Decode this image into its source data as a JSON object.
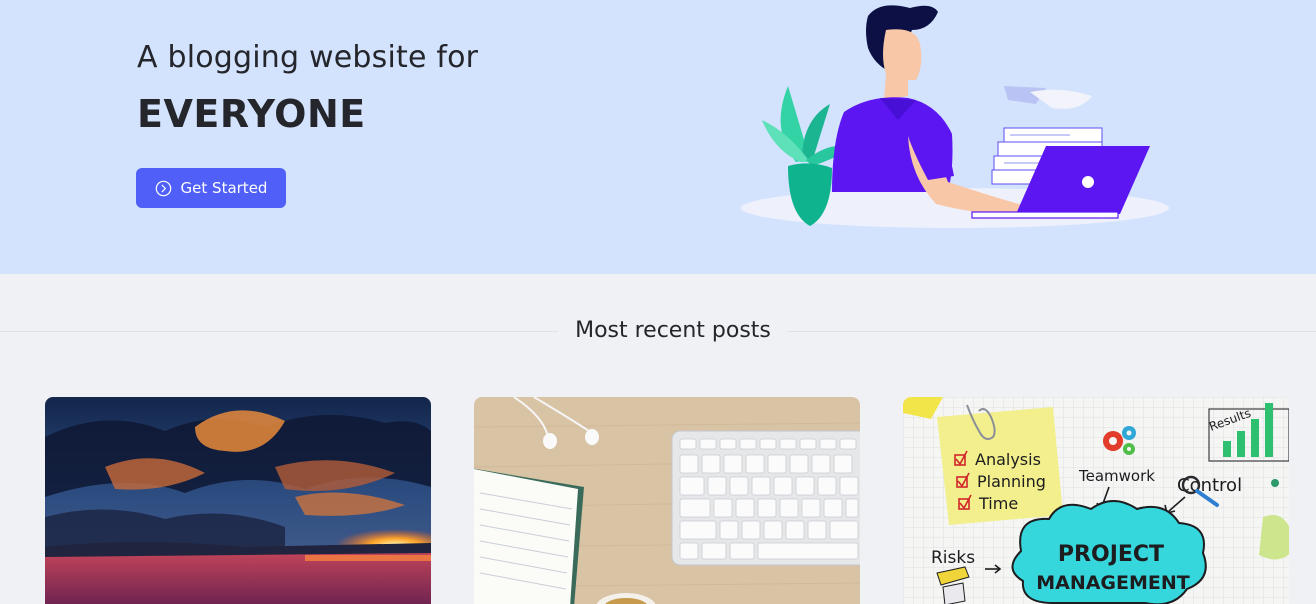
{
  "hero": {
    "subtitle": "A blogging website for",
    "title": "EVERYONE",
    "cta_label": "Get Started",
    "cta_icon": "circle-chevron-right-icon",
    "background": "#d3e3fd",
    "accent": "#4f5ff7"
  },
  "recent": {
    "heading": "Most recent posts",
    "cards": [
      {
        "image": "sunset-clouds-photo"
      },
      {
        "image": "desk-keyboard-earphones-photo"
      },
      {
        "image": "project-management-sketch-photo",
        "note_lines": [
          "Analysis",
          "Planning",
          "Time"
        ],
        "labels": {
          "teamwork": "Teamwork",
          "control": "Control",
          "results": "Results",
          "risks": "Risks",
          "project": "PROJECT",
          "management": "MANAGEMENT"
        }
      }
    ]
  }
}
